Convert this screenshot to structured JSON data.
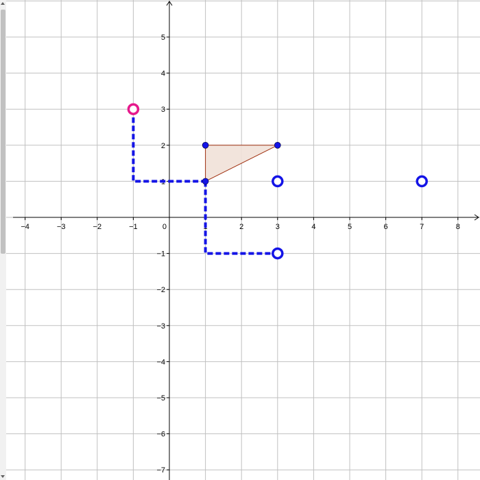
{
  "graph": {
    "x_range": [
      -4.4,
      8.5
    ],
    "y_range": [
      -7.2,
      6
    ],
    "x_ticks": [
      "−4",
      "−3",
      "−2",
      "−1",
      "0",
      "1",
      "2",
      "3",
      "4",
      "5",
      "6",
      "7",
      "8"
    ],
    "y_ticks": [
      "−7",
      "−6",
      "−5",
      "−4",
      "−3",
      "−2",
      "−1",
      "1",
      "2",
      "3",
      "4",
      "5"
    ],
    "origin_label": "0",
    "grid": true
  },
  "shapes": {
    "triangle": {
      "vertices": [
        [
          1,
          1
        ],
        [
          1,
          2
        ],
        [
          3,
          2
        ]
      ],
      "fill": "#f1e1d8",
      "stroke": "#a03010"
    },
    "points": [
      {
        "x": 1,
        "y": 2,
        "style": "filled",
        "color": "#1414e6"
      },
      {
        "x": 3,
        "y": 2,
        "style": "filled",
        "color": "#1414e6"
      },
      {
        "x": 1,
        "y": 1,
        "style": "filled",
        "color": "#1414e6"
      },
      {
        "x": -1,
        "y": 3,
        "style": "open",
        "color": "#e6198c"
      },
      {
        "x": 3,
        "y": 1,
        "style": "open",
        "color": "#1414e6"
      },
      {
        "x": 7,
        "y": 1,
        "style": "open",
        "color": "#1414e6"
      },
      {
        "x": 3,
        "y": -1,
        "style": "open",
        "color": "#1414e6"
      }
    ],
    "dashed_paths": [
      {
        "points": [
          [
            -1,
            3
          ],
          [
            -1,
            1
          ],
          [
            1,
            1
          ]
        ],
        "color": "#1414e6"
      },
      {
        "points": [
          [
            1,
            1
          ],
          [
            1,
            -1
          ],
          [
            3,
            -1
          ]
        ],
        "color": "#1414e6"
      }
    ]
  }
}
